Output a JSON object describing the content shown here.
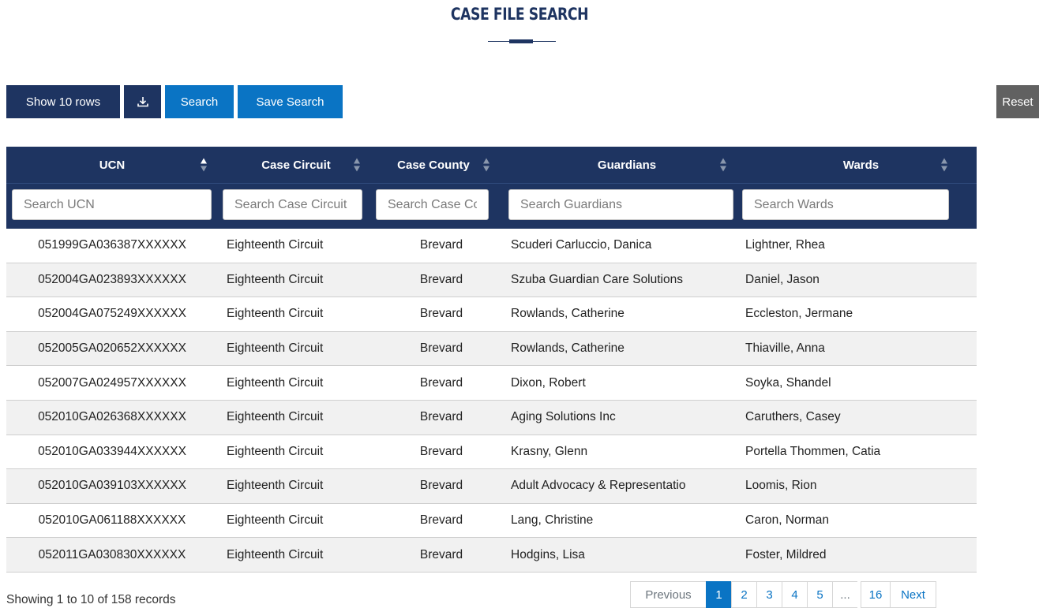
{
  "page": {
    "title": "CASE FILE SEARCH"
  },
  "toolbar": {
    "show_rows_label": "Show 10 rows",
    "download_icon": "download-icon",
    "search_label": "Search",
    "save_search_label": "Save Search",
    "reset_label": "Reset"
  },
  "table": {
    "columns": [
      {
        "label": "UCN",
        "sort": "asc"
      },
      {
        "label": "Case Circuit",
        "sort": "none"
      },
      {
        "label": "Case County",
        "sort": "none"
      },
      {
        "label": "Guardians",
        "sort": "none"
      },
      {
        "label": "Wards",
        "sort": "none"
      }
    ],
    "filters": [
      {
        "placeholder": "Search UCN",
        "value": ""
      },
      {
        "placeholder": "Search Case Circuit",
        "value": ""
      },
      {
        "placeholder": "Search Case County",
        "value": ""
      },
      {
        "placeholder": "Search Guardians",
        "value": ""
      },
      {
        "placeholder": "Search Wards",
        "value": ""
      }
    ],
    "rows": [
      [
        "051999GA036387XXXXXX",
        "Eighteenth Circuit",
        "Brevard",
        "Scuderi Carluccio, Danica",
        "Lightner, Rhea"
      ],
      [
        "052004GA023893XXXXXX",
        "Eighteenth Circuit",
        "Brevard",
        "Szuba Guardian Care Solutions",
        "Daniel, Jason"
      ],
      [
        "052004GA075249XXXXXX",
        "Eighteenth Circuit",
        "Brevard",
        "Rowlands, Catherine",
        "Eccleston, Jermane"
      ],
      [
        "052005GA020652XXXXXX",
        "Eighteenth Circuit",
        "Brevard",
        "Rowlands, Catherine",
        "Thiaville, Anna"
      ],
      [
        "052007GA024957XXXXXX",
        "Eighteenth Circuit",
        "Brevard",
        "Dixon, Robert",
        "Soyka, Shandel"
      ],
      [
        "052010GA026368XXXXXX",
        "Eighteenth Circuit",
        "Brevard",
        "Aging Solutions Inc",
        "Caruthers, Casey"
      ],
      [
        "052010GA033944XXXXXX",
        "Eighteenth Circuit",
        "Brevard",
        "Krasny, Glenn",
        "Portella Thommen, Catia"
      ],
      [
        "052010GA039103XXXXXX",
        "Eighteenth Circuit",
        "Brevard",
        "Adult Advocacy & Representatio",
        "Loomis, Rion"
      ],
      [
        "052010GA061188XXXXXX",
        "Eighteenth Circuit",
        "Brevard",
        "Lang, Christine",
        "Caron, Norman"
      ],
      [
        "052011GA030830XXXXXX",
        "Eighteenth Circuit",
        "Brevard",
        "Hodgins, Lisa",
        "Foster, Mildred"
      ]
    ]
  },
  "footer": {
    "info": "Showing 1 to 10 of 158 records",
    "pager": {
      "previous": "Previous",
      "pages": [
        "1",
        "2",
        "3",
        "4",
        "5"
      ],
      "current": "1",
      "ellipsis": "...",
      "last": "16",
      "next": "Next"
    }
  },
  "colors": {
    "navy": "#1e3461",
    "blue": "#0a74c4",
    "reset": "#616161"
  }
}
